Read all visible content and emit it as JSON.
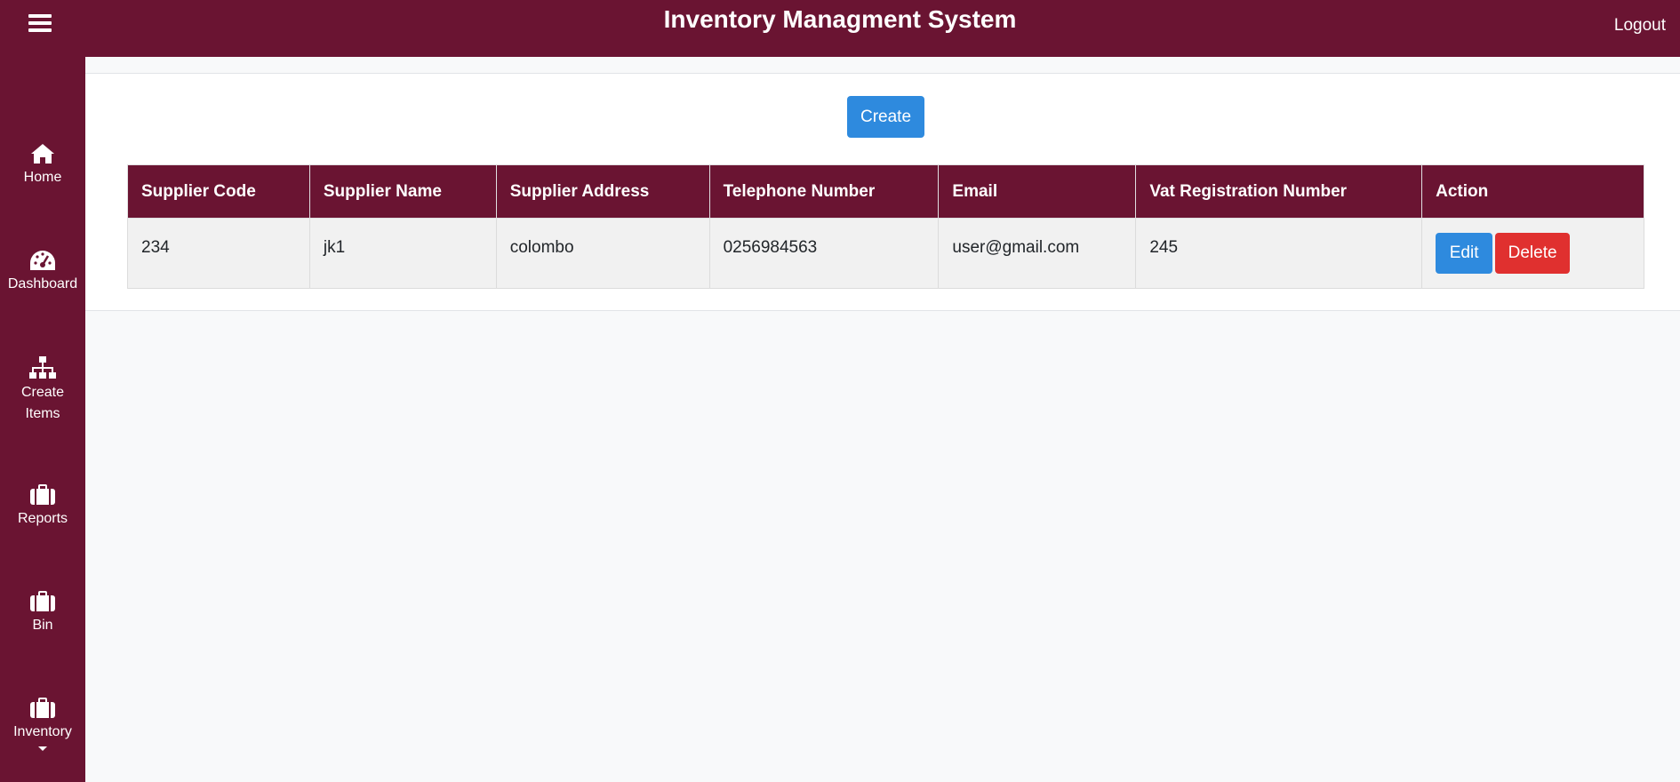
{
  "header": {
    "title": "Inventory Managment System",
    "logout_label": "Logout"
  },
  "sidebar": {
    "items": [
      {
        "label": "Home",
        "icon": "home-icon"
      },
      {
        "label": "Dashboard",
        "icon": "dashboard-icon"
      },
      {
        "label": "Create\nItems",
        "icon": "sitemap-icon"
      },
      {
        "label": "Reports",
        "icon": "briefcase-icon"
      },
      {
        "label": "Bin",
        "icon": "briefcase-icon"
      },
      {
        "label": "Inventory",
        "icon": "briefcase-icon"
      }
    ]
  },
  "main": {
    "create_label": "Create",
    "table": {
      "columns": [
        "Supplier Code",
        "Supplier Name",
        "Supplier Address",
        "Telephone Number",
        "Email",
        "Vat Registration Number",
        "Action"
      ],
      "rows": [
        {
          "code": "234",
          "name": "jk1",
          "address": "colombo",
          "telephone": "0256984563",
          "email": "user@gmail.com",
          "vat": "245"
        }
      ],
      "edit_label": "Edit",
      "delete_label": "Delete"
    }
  },
  "colors": {
    "brand": "#6a1432",
    "primary": "#2e8ade",
    "danger": "#e0302f"
  }
}
